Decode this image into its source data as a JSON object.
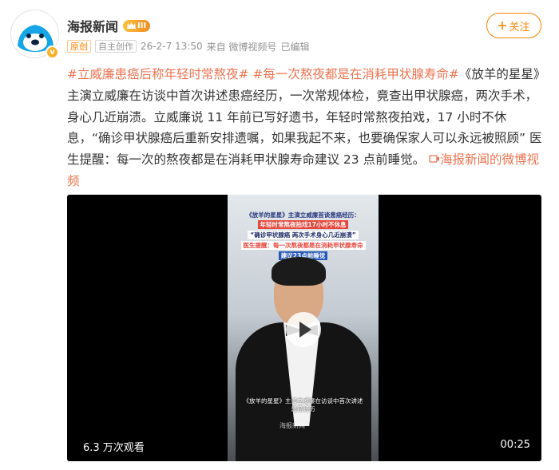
{
  "account": {
    "name": "海报新闻",
    "level": "III",
    "verified_badge": "v"
  },
  "meta": {
    "tags": [
      "原创",
      "自主创作"
    ],
    "time": "26-2-7 13:50",
    "source": "来自 微博视频号",
    "edited": "已编辑"
  },
  "follow": {
    "label": "关注",
    "icon": "plus-icon"
  },
  "post": {
    "topic1": "#立威廉患癌后称年轻时常熬夜#",
    "topic2": "#每一次熬夜都是在消耗甲状腺寿命#",
    "body": "《放羊的星星》主演立威廉在访谈中首次讲述患癌经历，一次常规体检，竟查出甲状腺癌，两次手术，身心几近崩溃。立威廉说 11 年前已写好遗书，年轻时常熬夜拍戏，17 小时不休息，“确诊甲状腺癌后重新安排遗嘱，如果我起不来，也要确保家人可以永远被照顾” 医生提醒：每一次的熬夜都是在消耗甲状腺寿命建议 23 点前睡觉。",
    "source_link": "海报新闻的微博视频"
  },
  "video": {
    "banner": [
      "《放羊的星星》主演立威廉首谈患癌经历：",
      "年轻时常熬夜拍戏17小时不休息",
      "“确诊甲状腺癌 两次手术身心几近崩溃”",
      "医生提醒：每一次熬夜都是在消耗甲状腺寿命",
      "建议23点前睡觉"
    ],
    "subtitle": "《放羊的星星》主演立威廉在访谈中首次讲述患癌经历",
    "watermark": "海报新闻",
    "views": "6.3 万次观看",
    "duration": "00:25"
  },
  "colors": {
    "accent": "#ff8200",
    "topic": "#eb7350",
    "video_bg": "#000000"
  }
}
